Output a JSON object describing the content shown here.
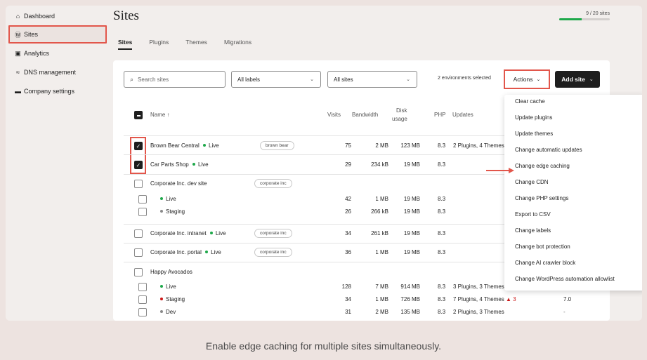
{
  "sidebar": {
    "items": [
      {
        "label": "Dashboard",
        "icon": "home-icon"
      },
      {
        "label": "Sites",
        "icon": "wordpress-icon"
      },
      {
        "label": "Analytics",
        "icon": "chart-icon"
      },
      {
        "label": "DNS management",
        "icon": "dns-icon"
      },
      {
        "label": "Company settings",
        "icon": "briefcase-icon"
      }
    ]
  },
  "header": {
    "title": "Sites",
    "usage_text": "9 / 20 sites",
    "usage_fraction": 0.45
  },
  "tabs": [
    "Sites",
    "Plugins",
    "Themes",
    "Migrations"
  ],
  "toolbar": {
    "search_placeholder": "Search sites",
    "labels_select": "All labels",
    "sites_select": "All sites",
    "env_selected": "2 environments selected",
    "actions_label": "Actions",
    "add_site_label": "Add site"
  },
  "table": {
    "columns": {
      "name": "Name ↑",
      "visits": "Visits",
      "bandwidth": "Bandwidth",
      "disk_line1": "Disk",
      "disk_line2": "usage",
      "php": "PHP",
      "updates": "Updates"
    },
    "rows": [
      {
        "name": "Brown Bear Central",
        "status": "Live",
        "tag": "brown bear",
        "visits": "75",
        "bandwidth": "2 MB",
        "disk": "123 MB",
        "php": "8.3",
        "updates": "2 Plugins, 4 Themes"
      },
      {
        "name": "Car Parts Shop",
        "status": "Live",
        "visits": "29",
        "bandwidth": "234 kB",
        "disk": "19 MB",
        "php": "8.3"
      },
      {
        "name": "Corporate Inc. dev site",
        "tag": "corporate inc"
      },
      {
        "env": "Live",
        "visits": "42",
        "bandwidth": "1 MB",
        "disk": "19 MB",
        "php": "8.3"
      },
      {
        "env": "Staging",
        "visits": "26",
        "bandwidth": "266 kB",
        "disk": "19 MB",
        "php": "8.3"
      },
      {
        "name": "Corporate Inc. intranet",
        "status": "Live",
        "tag": "corporate inc",
        "visits": "34",
        "bandwidth": "261 kB",
        "disk": "19 MB",
        "php": "8.3"
      },
      {
        "name": "Corporate Inc. portal",
        "status": "Live",
        "tag": "corporate inc",
        "visits": "36",
        "bandwidth": "1 MB",
        "disk": "19 MB",
        "php": "8.3"
      },
      {
        "name": "Happy Avocados"
      },
      {
        "env": "Live",
        "visits": "128",
        "bandwidth": "7 MB",
        "disk": "914 MB",
        "php": "8.3",
        "updates": "3 Plugins, 3 Themes"
      },
      {
        "env": "Staging",
        "visits": "34",
        "bandwidth": "1 MB",
        "disk": "726 MB",
        "php": "8.3",
        "updates": "7 Plugins, 4 Themes",
        "warn": "3",
        "extra": "7.0"
      },
      {
        "env": "Dev",
        "visits": "31",
        "bandwidth": "2 MB",
        "disk": "135 MB",
        "php": "8.3",
        "updates": "2 Plugins, 3 Themes",
        "extra": "-"
      }
    ]
  },
  "actions_menu": [
    "Clear cache",
    "Update plugins",
    "Update themes",
    "Change automatic updates",
    "Change edge caching",
    "Change CDN",
    "Change PHP settings",
    "Export to CSV",
    "Change labels",
    "Change bot protection",
    "Change AI crawler block",
    "Change WordPress automation allowlist"
  ],
  "colors": {
    "highlight": "#e2564b",
    "live_dot": "#1ea84a",
    "staging_dot": "#cc1818",
    "muted_dot": "#8a8a8a"
  },
  "caption": "Enable edge caching for multiple sites simultaneously."
}
